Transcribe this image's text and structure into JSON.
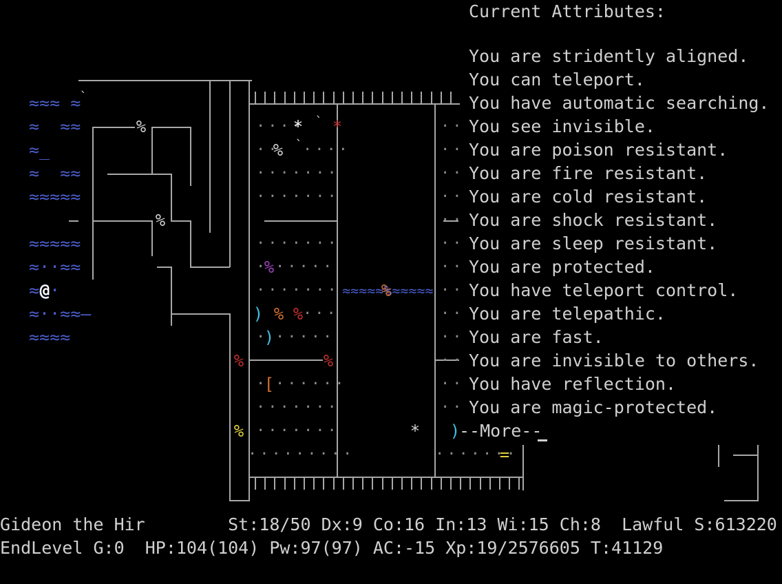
{
  "attributes": {
    "header": "Current Attributes:",
    "lines": [
      "You are stridently aligned.",
      "You can teleport.",
      "You have automatic searching.",
      "You see invisible.",
      "You are poison resistant.",
      "You are fire resistant.",
      "You are cold resistant.",
      "You are shock resistant.",
      "You are sleep resistant.",
      "You are protected.",
      "You have teleport control.",
      "You are telepathic.",
      "You are fast.",
      "You are invisible to others.",
      "You have reflection.",
      "You are magic-protected."
    ],
    "more_prompt": "--More--"
  },
  "status": {
    "line1": "Gideon the Hir        St:18/50 Dx:9 Co:16 In:13 Wi:15 Ch:8  Lawful S:613220",
    "line2": "EndLevel G:0  HP:104(104) Pw:97(97) AC:-15 Xp:19/2576605 T:41129"
  },
  "map": {
    "player": "@",
    "water_rows": [
      "≈≈≈ ≈",
      "≈  ≈≈",
      "≈_",
      "≈  ≈≈",
      "≈≈≈≈≈",
      "≈≈≈≈≈",
      "≈··≈≈",
      "≈@·",
      "≈··≈≈—",
      "≈≈≈≈"
    ],
    "moat_row": "≈≈≈≈≈%≈≈≈≈≈",
    "colors": {
      "water": "#4a5cc8",
      "food_red": "#c03030",
      "food_purple": "#a040c0",
      "food_orange": "#d07030",
      "food_yellow": "#e0d040",
      "armor_orange": "#d07030",
      "weapon_cyan": "#40c0e0",
      "ring_yellow": "#e0d040",
      "wall": "#a8a8a8",
      "text": "#d0d0d0"
    }
  }
}
